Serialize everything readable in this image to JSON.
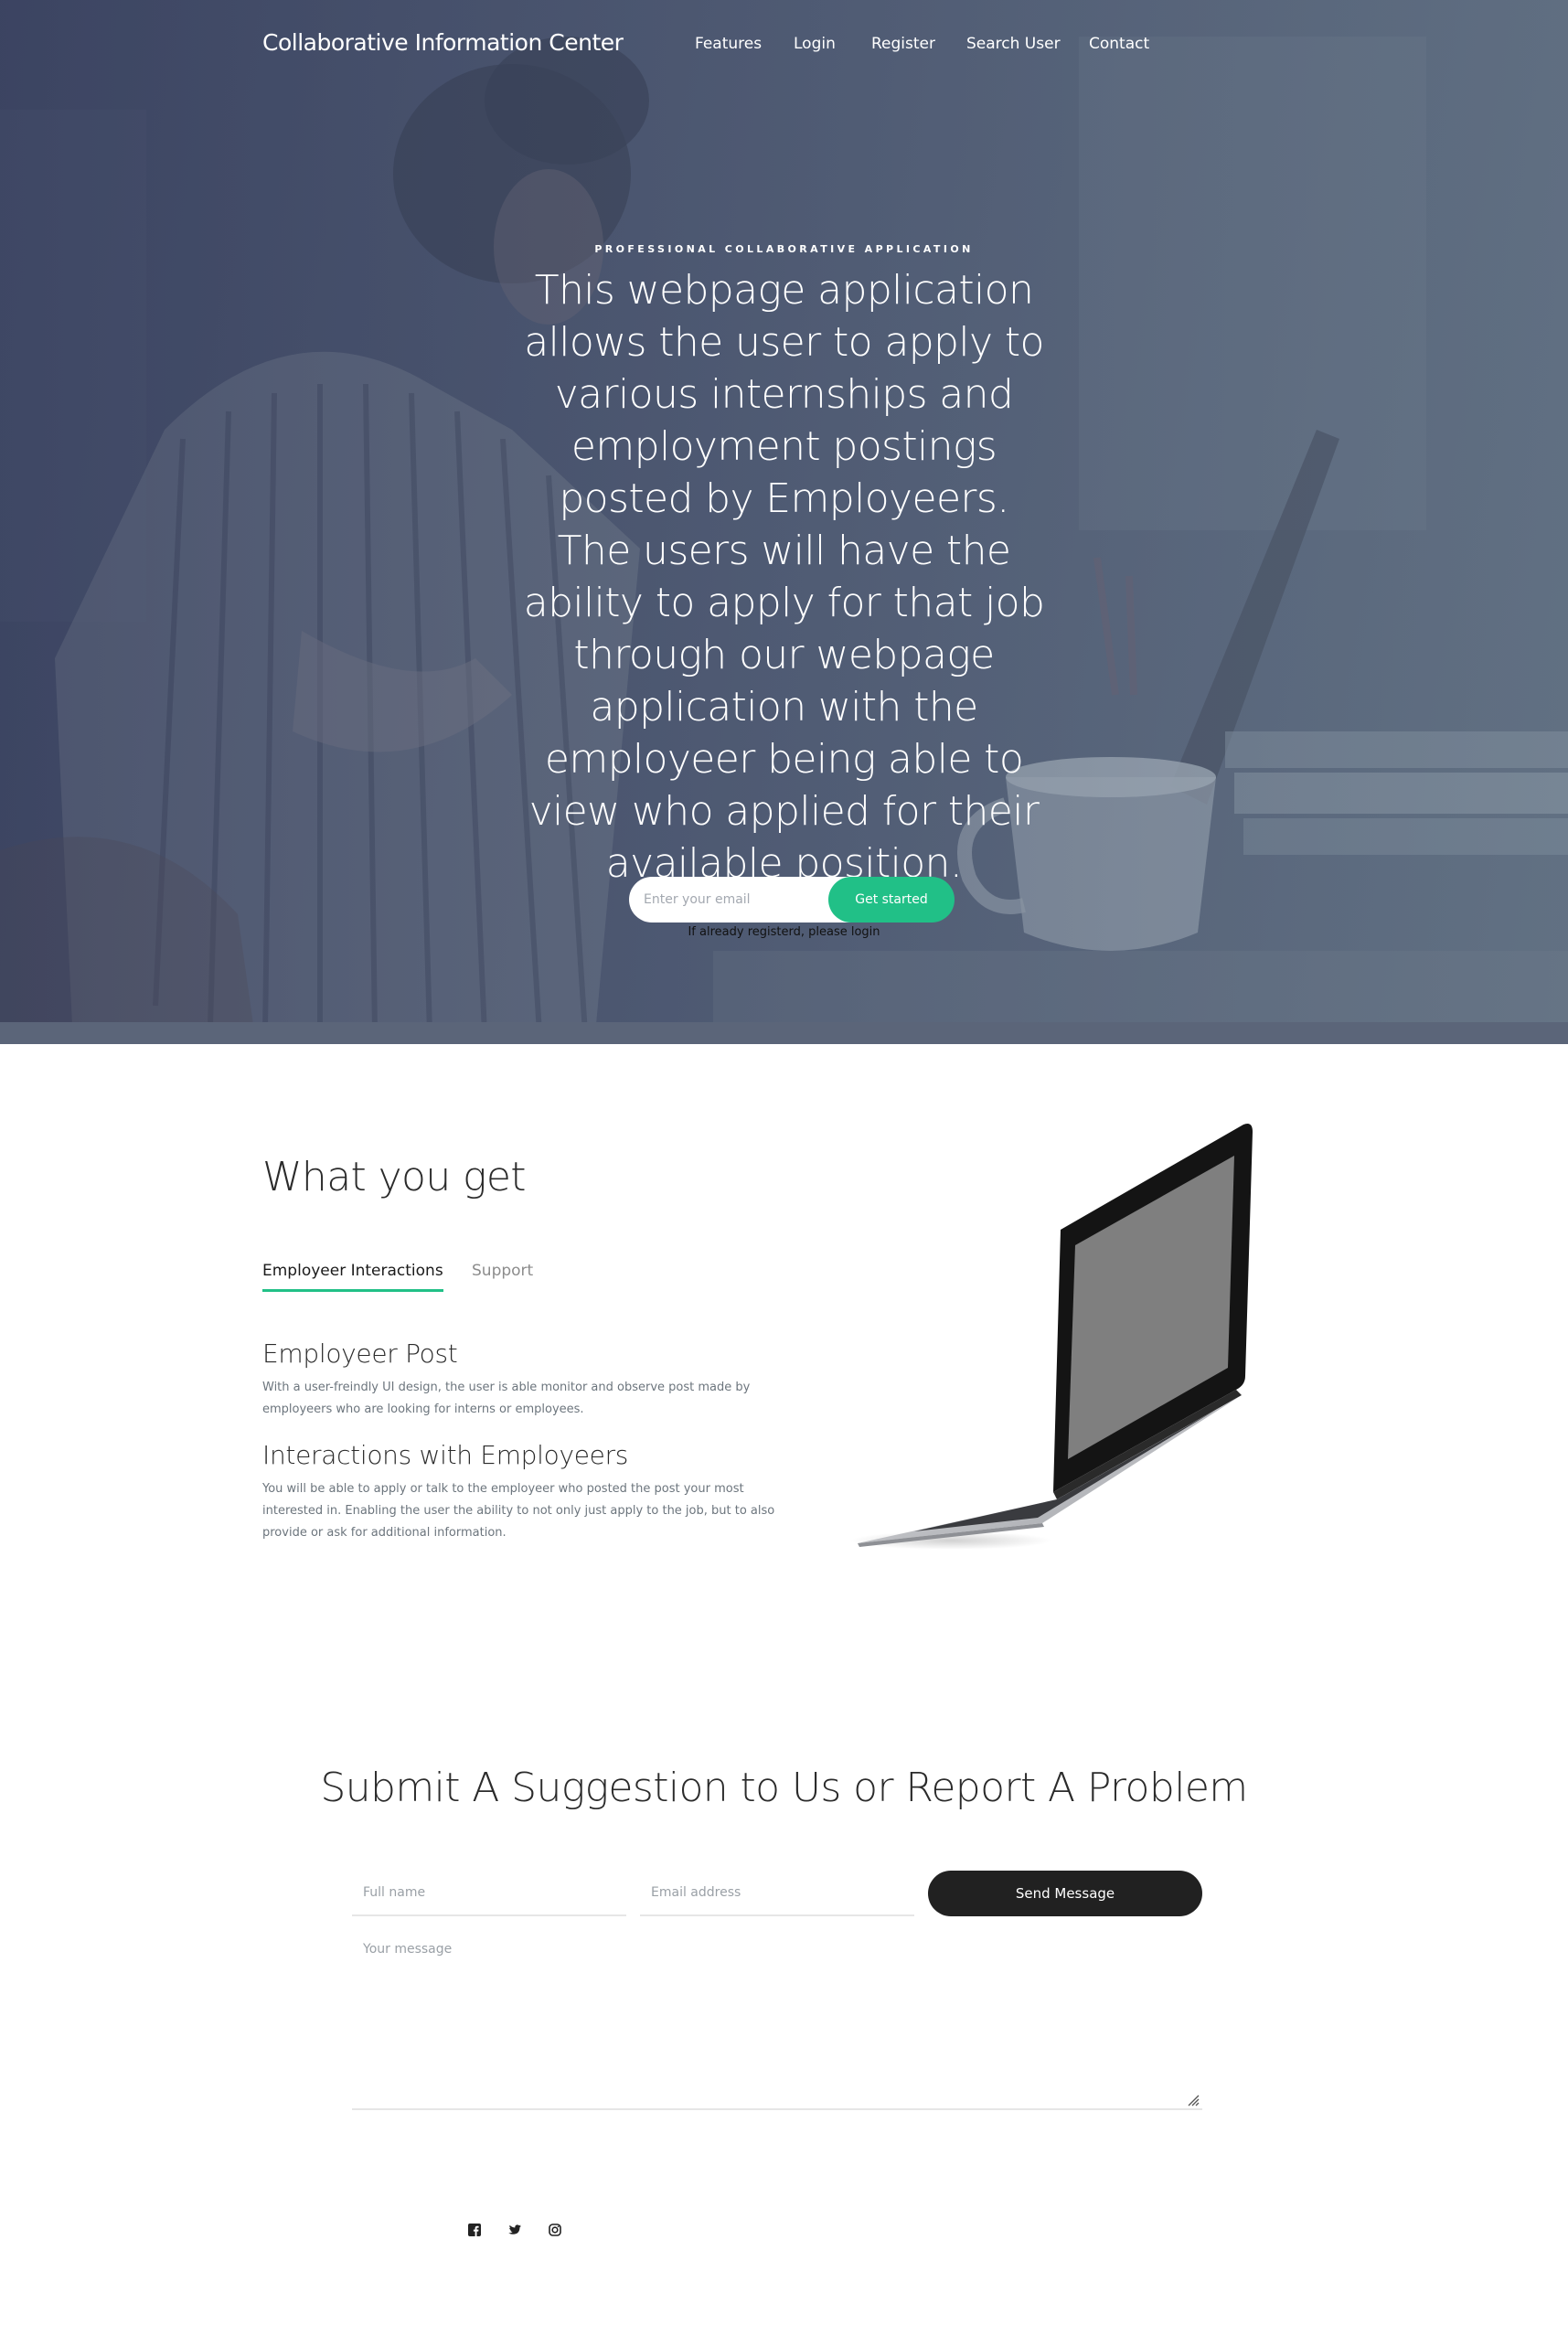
{
  "brand": "Collaborative Information Center",
  "nav": {
    "items": [
      "Features",
      "Login",
      "Register",
      "Search User",
      "Contact"
    ]
  },
  "hero": {
    "kicker": "PROFESSIONAL COLLABORATIVE APPLICATION",
    "heading": "This webpage application allows the user to apply to various internships and employment postings posted by Employeers. The users will have the ability to apply for that job through our webpage application with the employeer being able to view who applied for their available position.",
    "email_placeholder": "Enter your email",
    "cta_label": "Get started",
    "note": "If already registerd, please login"
  },
  "features": {
    "title": "What you get",
    "tabs": [
      "Employeer Interactions",
      "Support"
    ],
    "active_tab": "Employeer Interactions",
    "items": [
      {
        "title": "Employeer Post",
        "text": "With a user-freindly UI design, the user is able monitor and observe post made by employeers who are looking for interns or employees."
      },
      {
        "title": "Interactions with Employeers",
        "text": "You will be able to apply or talk to the employeer who posted the post your most interested in. Enabling the user the ability to not only just apply to the job, but to also provide or ask for additional information."
      }
    ]
  },
  "contact": {
    "title": "Submit A Suggestion to Us or Report A Problem",
    "name_placeholder": "Full name",
    "email_placeholder": "Email address",
    "message_placeholder": "Your message",
    "send_label": "Send Message"
  },
  "footer": {
    "social_icons": [
      "facebook-icon",
      "twitter-icon",
      "instagram-icon"
    ]
  },
  "colors": {
    "accent": "#21c087",
    "hero_overlay": "#4b5670",
    "dark_button": "#212121"
  }
}
